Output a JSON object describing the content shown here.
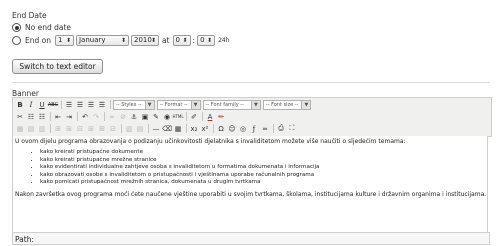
{
  "end_date": {
    "title": "End Date",
    "no_end_date_label": "No end date",
    "end_on_label": "End on",
    "day": "1",
    "month": "January",
    "year": "2010",
    "at_label": "at",
    "hour": "0",
    "minute": "0",
    "format_label": "24h",
    "switch_button": "Switch to text editor"
  },
  "banner": {
    "title": "Banner",
    "toolbar": {
      "styles": "-- Styles --",
      "format": "-- Format --",
      "font_family": "-- Font family --",
      "font_size": "-- Font size --"
    },
    "content": {
      "intro": "U ovom dijelu programa obrazovanja o podizanju učinkovitosti djelatnika s invaliditetom možete više naučiti o sljedećim temama:",
      "items": [
        "kako kreirati pristupačne dokumente",
        "kako kreirati pristupačne mrežne stranice",
        "kako evidentirati individualne zahtjeve osoba s invaliditetom u formatima dokumenata i informacija",
        "kako obrazovati osobe s invaliditetom o pristupačnosti i vještinama uporabe računalnih programa",
        "kako pomicati pristupačnost mrežnih stranica, dokumenata u drugim tvrtkama"
      ],
      "outro": "Nakon završetka ovog programa moći ćete naučene vještine uporabiti u svojim tvrtkama, školama, institucijama kulture i državnim organima i institucijama."
    },
    "path_label": "Path:"
  }
}
